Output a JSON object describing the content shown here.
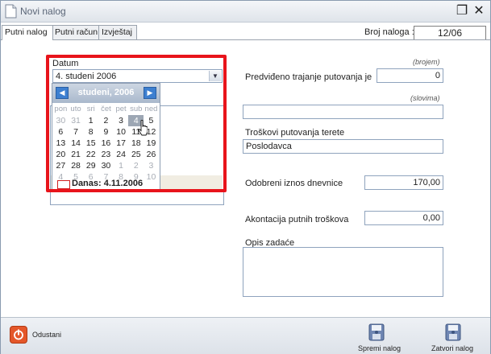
{
  "window": {
    "title": "Novi nalog"
  },
  "tabs": [
    "Putni nalog",
    "Putni račun",
    "Izvještaj"
  ],
  "broj_naloga": {
    "label": "Broj naloga :",
    "value": "12/06"
  },
  "datum": {
    "label": "Datum",
    "value": "4. studeni 2006"
  },
  "calendar": {
    "title": "studeni, 2006",
    "weekdays": [
      "pon",
      "uto",
      "sri",
      "čet",
      "pet",
      "sub",
      "ned"
    ],
    "weeks": [
      [
        "30",
        "31",
        "1",
        "2",
        "3",
        "4",
        "5"
      ],
      [
        "6",
        "7",
        "8",
        "9",
        "10",
        "11",
        "12"
      ],
      [
        "13",
        "14",
        "15",
        "16",
        "17",
        "18",
        "19"
      ],
      [
        "20",
        "21",
        "22",
        "23",
        "24",
        "25",
        "26"
      ],
      [
        "27",
        "28",
        "29",
        "30",
        "1",
        "2",
        "3"
      ],
      [
        "4",
        "5",
        "6",
        "7",
        "8",
        "9",
        "10"
      ]
    ],
    "selected": "4",
    "today_label": "Danas: 4.11.2006"
  },
  "trajanje": {
    "label": "Predviđeno trajanje putovanja je",
    "hint_brojem": "(brojem)",
    "value_brojem": "0",
    "hint_slovima": "(slovima)",
    "value_slovima": ""
  },
  "troskovi": {
    "label": "Troškovi putovanja terete",
    "value": "Poslodavca"
  },
  "dnevnica": {
    "label": "Odobreni iznos dnevnice",
    "value": "170,00"
  },
  "akontacija": {
    "label": "Akontacija putnih troškova",
    "value": "0,00"
  },
  "opis": {
    "label": "Opis zadaće",
    "value": ""
  },
  "footer": {
    "cancel_label": "Odustani",
    "save_label": "Spremi nalog",
    "close_label": "Zatvori nalog"
  }
}
